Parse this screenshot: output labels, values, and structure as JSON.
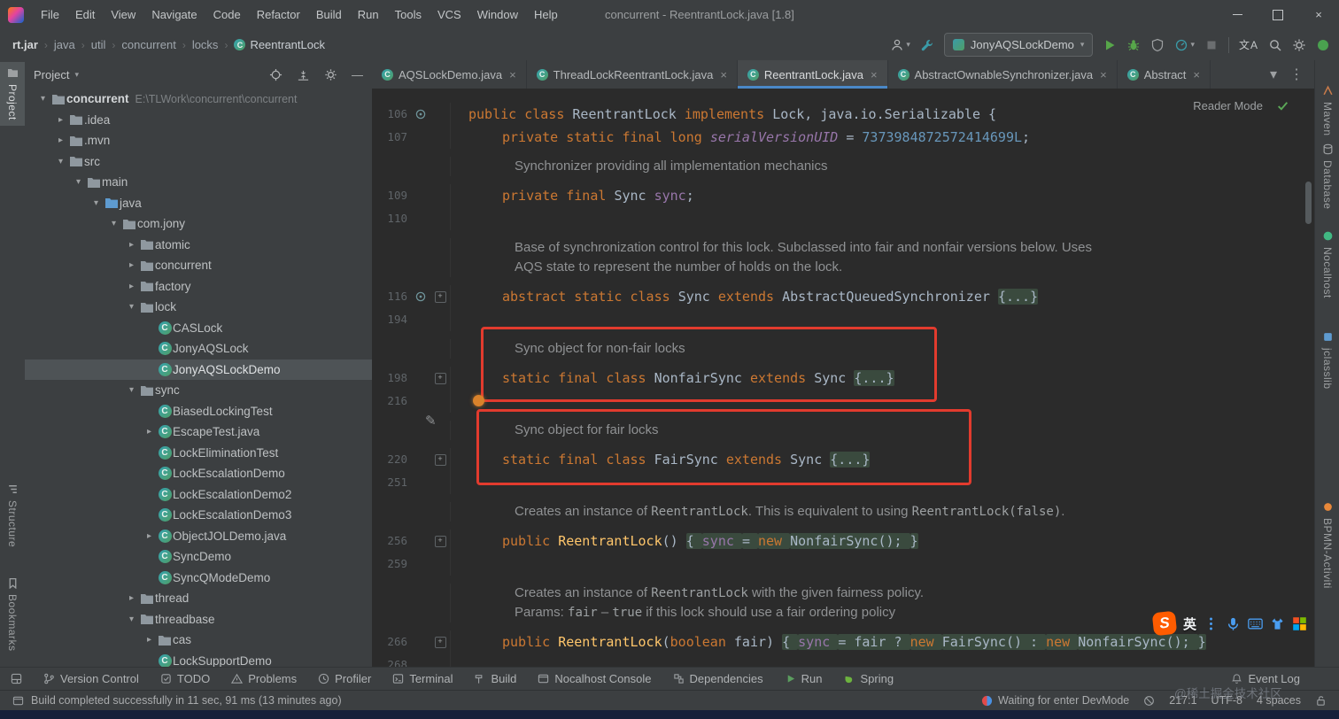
{
  "window": {
    "title": "concurrent - ReentrantLock.java [1.8]",
    "menus": [
      "File",
      "Edit",
      "View",
      "Navigate",
      "Code",
      "Refactor",
      "Build",
      "Run",
      "Tools",
      "VCS",
      "Window",
      "Help"
    ]
  },
  "navbar": {
    "crumbs": [
      "rt.jar",
      "java",
      "util",
      "concurrent",
      "locks",
      "ReentrantLock"
    ],
    "run_config": "JonyAQSLockDemo"
  },
  "stripes": {
    "left": [
      {
        "label": "Project",
        "icon": "project",
        "active": true
      },
      {
        "label": "Structure",
        "icon": "structure"
      },
      {
        "label": "Bookmarks",
        "icon": "bookmarks"
      }
    ],
    "right": [
      {
        "label": "Maven",
        "icon": "maven"
      },
      {
        "label": "Database",
        "icon": "db"
      },
      {
        "label": "Nocalhost",
        "icon": "nocalhost"
      },
      {
        "label": "jclasslib",
        "icon": "jclasslib"
      },
      {
        "label": "BPMN-Activiti",
        "icon": "bpmn"
      }
    ]
  },
  "project": {
    "title": "Project",
    "tree": [
      {
        "l": "concurrent",
        "hint": "E:\\TLWork\\concurrent\\concurrent",
        "d": 0,
        "chev": "open",
        "icon": "folder",
        "bold": true
      },
      {
        "l": ".idea",
        "d": 1,
        "chev": "closed",
        "icon": "folder"
      },
      {
        "l": ".mvn",
        "d": 1,
        "chev": "closed",
        "icon": "folder"
      },
      {
        "l": "src",
        "d": 1,
        "chev": "open",
        "icon": "folder"
      },
      {
        "l": "main",
        "d": 2,
        "chev": "open",
        "icon": "folder"
      },
      {
        "l": "java",
        "d": 3,
        "chev": "open",
        "icon": "folder-src"
      },
      {
        "l": "com.jony",
        "d": 4,
        "chev": "open",
        "icon": "folder"
      },
      {
        "l": "atomic",
        "d": 5,
        "chev": "closed",
        "icon": "folder"
      },
      {
        "l": "concurrent",
        "d": 5,
        "chev": "closed",
        "icon": "folder"
      },
      {
        "l": "factory",
        "d": 5,
        "chev": "closed",
        "icon": "folder"
      },
      {
        "l": "lock",
        "d": 5,
        "chev": "open",
        "icon": "folder"
      },
      {
        "l": "CASLock",
        "d": 6,
        "chev": "none",
        "icon": "class"
      },
      {
        "l": "JonyAQSLock",
        "d": 6,
        "chev": "none",
        "icon": "class"
      },
      {
        "l": "JonyAQSLockDemo",
        "d": 6,
        "chev": "none",
        "icon": "class",
        "sel": true
      },
      {
        "l": "sync",
        "d": 5,
        "chev": "open",
        "icon": "folder"
      },
      {
        "l": "BiasedLockingTest",
        "d": 6,
        "chev": "none",
        "icon": "class"
      },
      {
        "l": "EscapeTest.java",
        "d": 6,
        "chev": "closed",
        "icon": "class"
      },
      {
        "l": "LockEliminationTest",
        "d": 6,
        "chev": "none",
        "icon": "class"
      },
      {
        "l": "LockEscalationDemo",
        "d": 6,
        "chev": "none",
        "icon": "class"
      },
      {
        "l": "LockEscalationDemo2",
        "d": 6,
        "chev": "none",
        "icon": "class"
      },
      {
        "l": "LockEscalationDemo3",
        "d": 6,
        "chev": "none",
        "icon": "class"
      },
      {
        "l": "ObjectJOLDemo.java",
        "d": 6,
        "chev": "closed",
        "icon": "class"
      },
      {
        "l": "SyncDemo",
        "d": 6,
        "chev": "none",
        "icon": "class"
      },
      {
        "l": "SyncQModeDemo",
        "d": 6,
        "chev": "none",
        "icon": "class"
      },
      {
        "l": "thread",
        "d": 5,
        "chev": "closed",
        "icon": "folder"
      },
      {
        "l": "threadbase",
        "d": 5,
        "chev": "open",
        "icon": "folder"
      },
      {
        "l": "cas",
        "d": 6,
        "chev": "closed",
        "icon": "folder"
      },
      {
        "l": "LockSupportDemo",
        "d": 6,
        "chev": "none",
        "icon": "class"
      }
    ]
  },
  "tabs": {
    "items": [
      {
        "label": "AQSLockDemo.java"
      },
      {
        "label": "ThreadLockReentrantLock.java"
      },
      {
        "label": "ReentrantLock.java",
        "active": true
      },
      {
        "label": "AbstractOwnableSynchronizer.java"
      },
      {
        "label": "Abstract",
        "partial": true
      }
    ]
  },
  "editor": {
    "reader_mode": "Reader Mode",
    "rows": [
      {
        "num": "106",
        "icon": true,
        "ind": 0,
        "segs": [
          [
            "kw",
            "public class "
          ],
          [
            "def",
            "ReentrantLock "
          ],
          [
            "kw",
            "implements "
          ],
          [
            "def",
            "Lock, java.io.Serializable {"
          ]
        ]
      },
      {
        "num": "107",
        "ind": 1,
        "segs": [
          [
            "kw",
            "private static final long "
          ],
          [
            "sfld",
            "serialVersionUID "
          ],
          [
            "def",
            "= "
          ],
          [
            "num",
            "7373984872572414699L"
          ],
          [
            "def",
            ";"
          ]
        ]
      },
      {
        "doc": true,
        "mt": 9,
        "segs": [
          [
            "doc",
            "Synchronizer providing all implementation mechanics"
          ]
        ]
      },
      {
        "num": "109",
        "ind": 1,
        "mt": 9,
        "segs": [
          [
            "kw",
            "private final "
          ],
          [
            "def",
            "Sync "
          ],
          [
            "fld",
            "sync"
          ],
          [
            "def",
            ";"
          ]
        ]
      },
      {
        "num": "110",
        "segs": []
      },
      {
        "doc": true,
        "mt": 9,
        "segs": [
          [
            "doc",
            "Base of synchronization control for this lock. Subclassed into fair and nonfair versions below. Uses"
          ]
        ]
      },
      {
        "doc": true,
        "segs": [
          [
            "doc",
            "AQS state to represent the number of holds on the lock."
          ]
        ]
      },
      {
        "num": "116",
        "icon": true,
        "fold": true,
        "ind": 1,
        "mt": 9,
        "segs": [
          [
            "kw",
            "abstract static class "
          ],
          [
            "def",
            "Sync "
          ],
          [
            "kw",
            "extends "
          ],
          [
            "def",
            "AbstractQueuedSynchronizer "
          ],
          [
            "def",
            "{...}",
            1
          ]
        ]
      },
      {
        "num": "194",
        "segs": []
      },
      {
        "doc": true,
        "mt": 9,
        "segs": [
          [
            "doc",
            "Sync object for non-fair locks"
          ]
        ]
      },
      {
        "num": "198",
        "fold": true,
        "ind": 1,
        "mt": 9,
        "segs": [
          [
            "kw",
            "static final class "
          ],
          [
            "def",
            "NonfairSync "
          ],
          [
            "kw",
            "extends "
          ],
          [
            "def",
            "Sync "
          ],
          [
            "def",
            "{...}",
            1
          ]
        ]
      },
      {
        "num": "216",
        "segs": []
      },
      {
        "doc": true,
        "mt": 9,
        "segs": [
          [
            "doc",
            "Sync object for fair locks"
          ]
        ]
      },
      {
        "num": "220",
        "fold": true,
        "ind": 1,
        "mt": 9,
        "segs": [
          [
            "kw",
            "static final class "
          ],
          [
            "def",
            "FairSync "
          ],
          [
            "kw",
            "extends "
          ],
          [
            "def",
            "Sync "
          ],
          [
            "def",
            "{...}",
            1
          ]
        ]
      },
      {
        "num": "251",
        "segs": []
      },
      {
        "doc": true,
        "mt": 9,
        "segs": [
          [
            "doc",
            "Creates an instance of "
          ],
          [
            "dcode",
            "ReentrantLock"
          ],
          [
            "doc",
            ". This is equivalent to using "
          ],
          [
            "dcode",
            "ReentrantLock(false)"
          ],
          [
            "doc",
            "."
          ]
        ]
      },
      {
        "num": "256",
        "fold": true,
        "ind": 1,
        "mt": 9,
        "segs": [
          [
            "kw",
            "public "
          ],
          [
            "mth",
            "ReentrantLock"
          ],
          [
            "def",
            "() "
          ],
          [
            "def",
            "{ ",
            1
          ],
          [
            "fld",
            "sync ",
            1
          ],
          [
            "def",
            "= ",
            1
          ],
          [
            "kw",
            "new ",
            1
          ],
          [
            "def",
            "NonfairSync(); ",
            1
          ],
          [
            "def",
            "}",
            1
          ]
        ]
      },
      {
        "num": "259",
        "segs": []
      },
      {
        "doc": true,
        "mt": 9,
        "segs": [
          [
            "doc",
            "Creates an instance of "
          ],
          [
            "dcode",
            "ReentrantLock"
          ],
          [
            "doc",
            " with the given fairness policy."
          ]
        ]
      },
      {
        "doc": true,
        "segs": [
          [
            "doc",
            "Params: "
          ],
          [
            "dcode",
            "fair"
          ],
          [
            "doc",
            " – "
          ],
          [
            "dcode",
            "true"
          ],
          [
            "doc",
            " if this lock should use a fair ordering policy"
          ]
        ]
      },
      {
        "num": "266",
        "fold": true,
        "ind": 1,
        "mt": 9,
        "segs": [
          [
            "kw",
            "public "
          ],
          [
            "mth",
            "ReentrantLock"
          ],
          [
            "def",
            "("
          ],
          [
            "kw",
            "boolean "
          ],
          [
            "def",
            "fair) "
          ],
          [
            "def",
            "{ ",
            1
          ],
          [
            "fld",
            "sync ",
            1
          ],
          [
            "def",
            "= fair ? ",
            1
          ],
          [
            "kw",
            "new ",
            1
          ],
          [
            "def",
            "FairSync() : ",
            1
          ],
          [
            "kw",
            "new ",
            1
          ],
          [
            "def",
            "NonfairSync(); ",
            1
          ],
          [
            "def",
            "}",
            1
          ]
        ]
      },
      {
        "num": "268",
        "segs": []
      }
    ]
  },
  "bottom": {
    "items": [
      {
        "label": "Version Control",
        "icon": "branch"
      },
      {
        "label": "TODO",
        "icon": "todo"
      },
      {
        "label": "Problems",
        "icon": "problems"
      },
      {
        "label": "Profiler",
        "icon": "profiler"
      },
      {
        "label": "Terminal",
        "icon": "terminal"
      },
      {
        "label": "Build",
        "icon": "build"
      },
      {
        "label": "Nocalhost Console",
        "icon": "console"
      },
      {
        "label": "Dependencies",
        "icon": "deps"
      },
      {
        "label": "Run",
        "icon": "run"
      },
      {
        "label": "Spring",
        "icon": "spring"
      }
    ],
    "right": "Event Log"
  },
  "status": {
    "message": "Build completed successfully in 11 sec, 91 ms (13 minutes ago)",
    "devmode": "Waiting for enter DevMode",
    "caret": "217:1",
    "encoding": "UTF-8",
    "indent": "4 spaces"
  },
  "overlays": {
    "watermark": "@稀土掘金技术社区",
    "ime_mode": "英"
  },
  "colors": {
    "accent": "#4a88c7",
    "keyword": "#cc7832",
    "number": "#6897bb",
    "field": "#9876aa",
    "method": "#ffc66b",
    "comment": "#8f9193",
    "red_box": "#e23b2e"
  }
}
